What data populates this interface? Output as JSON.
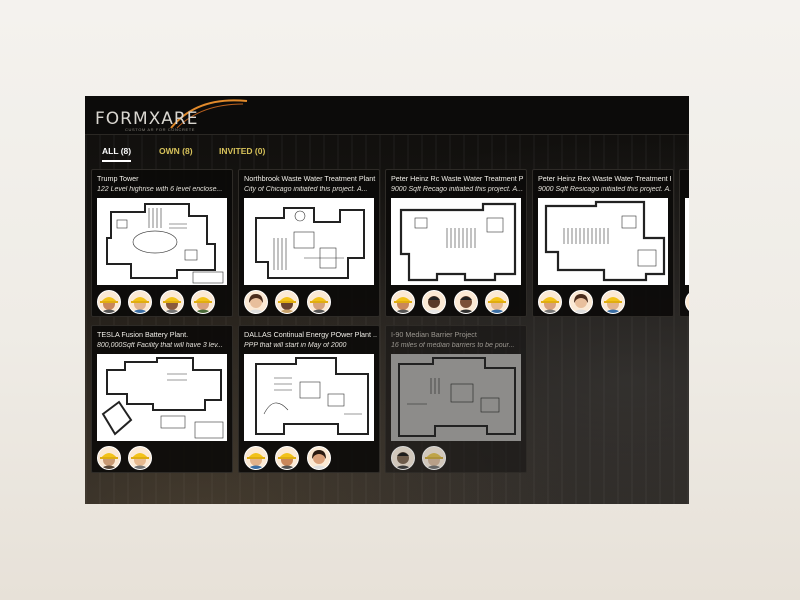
{
  "app": {
    "logo_text": "FORMXARE",
    "logo_tagline": "CUSTOM AR FOR CONCRETE"
  },
  "tabs": [
    {
      "label": "ALL (8)",
      "active": true
    },
    {
      "label": "OWN (8)",
      "active": false
    },
    {
      "label": "INVITED (0)",
      "active": false
    }
  ],
  "colors": {
    "accent_gold": "#d7c25a",
    "logo_swoosh": "#e28a2b",
    "header_bg": "#0c0b0a",
    "card_bg": "#0a0908"
  },
  "projects": [
    {
      "title": "Trump Tower",
      "description": "122 Level highrise with 6 level enclose...",
      "avatar_count": 4
    },
    {
      "title": "Northbrook Waste Water Treatment Plant",
      "description": "City of Chicago initiated this project. A...",
      "avatar_count": 3
    },
    {
      "title": "Peter Heinz Rc Waste Water Treatment Plant",
      "description": "9000 Sqft Recago initiated this project. A...",
      "avatar_count": 4
    },
    {
      "title": "Peter Heinz Rex Waste Water Treatment Pla",
      "description": "9000 Sqft Resicago initiated this project. A...",
      "avatar_count": 3
    },
    {
      "title": "TESLA Fusion Battery Plant.",
      "description": "800,000Sqft Facility that will have 3 lev...",
      "avatar_count": 2
    },
    {
      "title": "DALLAS Continual Energy POwer Plant ...",
      "description": "PPP that will start in May of 2000",
      "avatar_count": 3
    },
    {
      "title": "I-90 Median Barrier Project",
      "description": "16 miles of median barriers to be pour...",
      "avatar_count": 2
    }
  ]
}
